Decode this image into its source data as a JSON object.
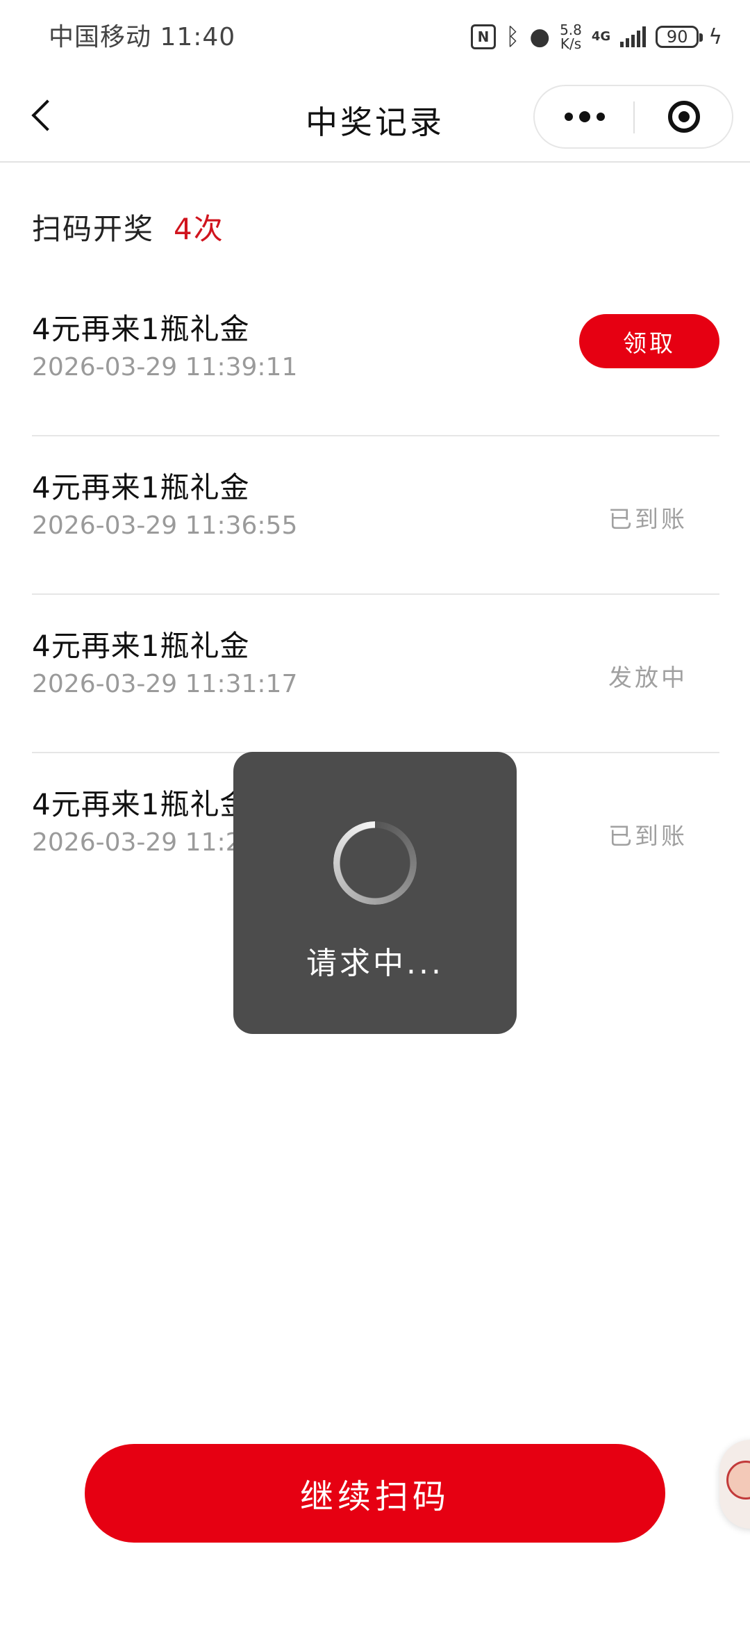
{
  "status_bar": {
    "carrier_time": "中国移动 11:40",
    "speed": [
      "5.8",
      "K/s"
    ],
    "network": "4G",
    "battery": "90"
  },
  "nav": {
    "title": "中奖记录"
  },
  "summary": {
    "label": "扫码开奖",
    "count": "4次"
  },
  "records": [
    {
      "title": "4元再来1瓶礼金",
      "time": "2026-03-29 11:39:11",
      "status": "领取",
      "status_type": "button"
    },
    {
      "title": "4元再来1瓶礼金",
      "time": "2026-03-29 11:36:55",
      "status": "已到账",
      "status_type": "text"
    },
    {
      "title": "4元再来1瓶礼金",
      "time": "2026-03-29 11:31:17",
      "status": "发放中",
      "status_type": "text"
    },
    {
      "title": "4元再来1瓶礼金",
      "time": "2026-03-29 11:28",
      "status": "已到账",
      "status_type": "text"
    }
  ],
  "toast": {
    "text": "请求中..."
  },
  "bottom": {
    "continue_label": "继续扫码"
  },
  "colors": {
    "accent_red": "#e60012",
    "count_red": "#d0141e",
    "toast_bg": "#4c4c4c"
  }
}
